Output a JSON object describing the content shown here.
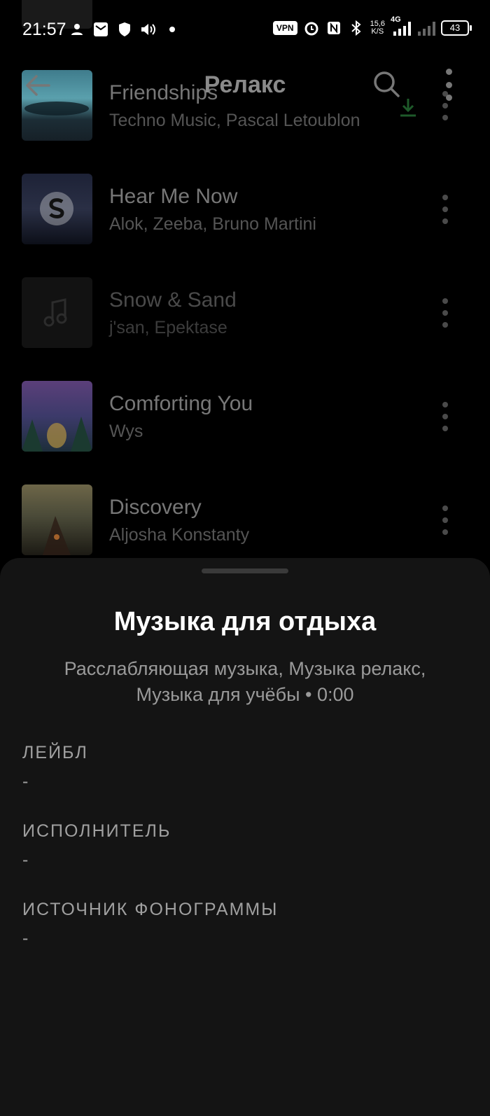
{
  "status_bar": {
    "time": "21:57",
    "vpn": "VPN",
    "speed_top": "15,6",
    "speed_bottom": "K/S",
    "network": "4G",
    "battery": "43"
  },
  "header": {
    "title": "Релакс"
  },
  "tracks": [
    {
      "title": "Friendships",
      "artist": "Techno Music, Pascal Letoublon",
      "cover_colors": [
        "#4b8ea0",
        "#1b2b33"
      ]
    },
    {
      "title": "Hear Me Now",
      "artist": "Alok, Zeeba, Bruno Martini",
      "cover_colors": [
        "#2b3550",
        "#0f1320"
      ]
    },
    {
      "title": "Snow & Sand",
      "artist": "j'san, Epektase",
      "cover_colors": [
        "#151515",
        "#151515"
      ]
    },
    {
      "title": "Comforting You",
      "artist": "Wys",
      "cover_colors": [
        "#6a4a8a",
        "#2a3a5a"
      ]
    },
    {
      "title": "Discovery",
      "artist": "Aljosha Konstanty",
      "cover_colors": [
        "#8a7a50",
        "#2a2418"
      ]
    }
  ],
  "sheet": {
    "title": "Музыка для отдыха",
    "subtitle_line1": "Расслабляющая музыка, Музыка релакс,",
    "subtitle_line2": "Музыка для учёбы • 0:00",
    "fields": [
      {
        "label": "ЛЕЙБЛ",
        "value": "-"
      },
      {
        "label": "ИСПОЛНИТЕЛЬ",
        "value": "-"
      },
      {
        "label": "ИСТОЧНИК ФОНОГРАММЫ",
        "value": "-"
      }
    ]
  },
  "colors": {
    "background": "#000000",
    "sheet": "#141414",
    "download_accent": "#1e5a2a"
  }
}
